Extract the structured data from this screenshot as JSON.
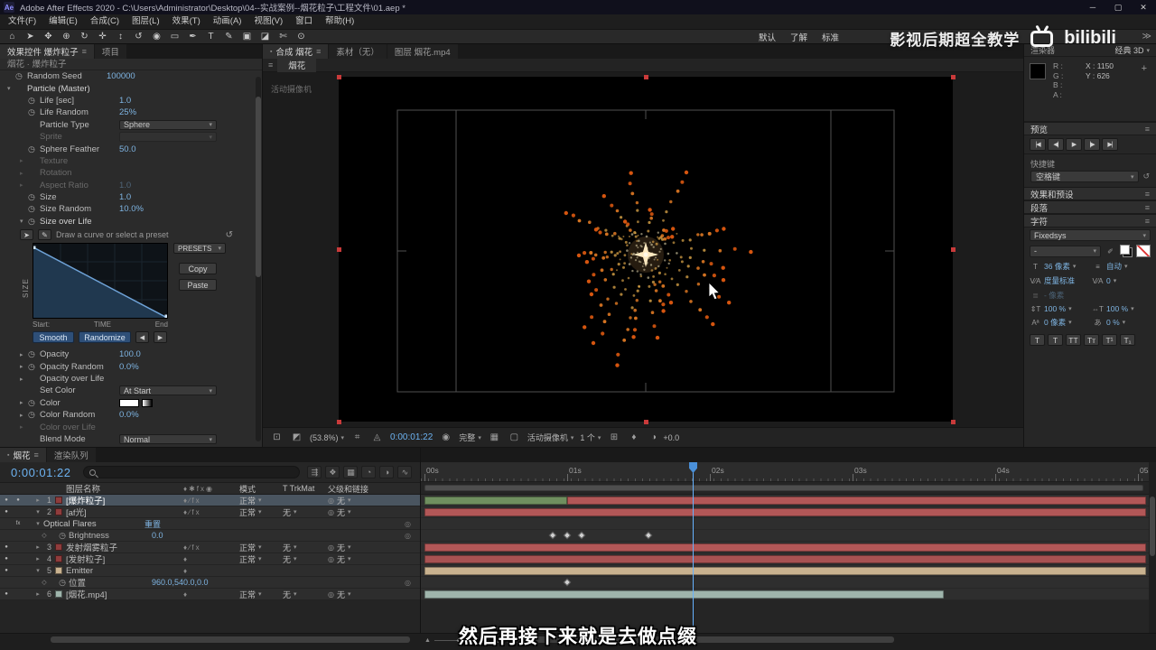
{
  "titlebar": {
    "logo": "Ae",
    "title": "Adobe After Effects 2020 - C:\\Users\\Administrator\\Desktop\\04--实战案例--烟花粒子\\工程文件\\01.aep *",
    "window_buttons": [
      "─",
      "▢",
      "✕"
    ]
  },
  "menubar": {
    "items": [
      "文件(F)",
      "编辑(E)",
      "合成(C)",
      "图层(L)",
      "效果(T)",
      "动画(A)",
      "视图(V)",
      "窗口",
      "帮助(H)"
    ]
  },
  "toolbar": {
    "tools": [
      {
        "g": "⌂",
        "n": "home-icon"
      },
      {
        "g": "➤",
        "n": "selection-tool"
      },
      {
        "g": "✥",
        "n": "hand-tool"
      },
      {
        "g": "⊕",
        "n": "zoom-tool"
      },
      {
        "g": "↻",
        "n": "orbit-camera-tool"
      },
      {
        "g": "✛",
        "n": "pan-camera-tool"
      },
      {
        "g": "↕",
        "n": "dolly-camera-tool"
      },
      {
        "g": "↺",
        "n": "rotation-tool"
      },
      {
        "g": "◉",
        "n": "pan-behind-tool"
      },
      {
        "g": "▭",
        "n": "shape-tool"
      },
      {
        "g": "✒",
        "n": "pen-tool"
      },
      {
        "g": "T",
        "n": "type-tool"
      },
      {
        "g": "✎",
        "n": "brush-tool"
      },
      {
        "g": "▣",
        "n": "clone-stamp-tool"
      },
      {
        "g": "◪",
        "n": "eraser-tool"
      },
      {
        "g": "✄",
        "n": "roto-brush-tool"
      },
      {
        "g": "⊙",
        "n": "puppet-pin-tool"
      }
    ],
    "workspaces": [
      "默认",
      "了解",
      "标准"
    ],
    "overflow": "≫",
    "watermark_text": "影视后期超全教学",
    "watermark_logo": "bilibili"
  },
  "effect_controls": {
    "tabs": [
      {
        "label": "效果控件 爆炸粒子",
        "cls": "active",
        "menu": 1
      },
      {
        "label": "项目"
      }
    ],
    "breadcrumb": "烟花 · 爆炸粒子",
    "rows_top": [
      {
        "tw": 1,
        "label": "Random Seed",
        "value": "100000",
        "nv": 1
      },
      {
        "a": "▾",
        "label": "Particle (Master)",
        "cls": "grp"
      },
      {
        "tw": 1,
        "label": "Life [sec]",
        "value": "1.0",
        "nv": 1,
        "cls": "i1"
      },
      {
        "tw": 1,
        "label": "Life Random",
        "value": "25%",
        "nv": 1,
        "cls": "i1"
      },
      {
        "label": "Particle Type",
        "value": "Sphere",
        "dd": 1,
        "cls": "i1"
      },
      {
        "label": "Sprite",
        "value": "",
        "dd": 1,
        "cls": "i1 dim"
      },
      {
        "tw": 1,
        "label": "Sphere Feather",
        "value": "50.0",
        "nv": 1,
        "cls": "i1"
      },
      {
        "a": "▸",
        "label": "Texture",
        "cls": "i1 dim"
      },
      {
        "a": "▸",
        "label": "Rotation",
        "cls": "i1 dim"
      },
      {
        "a": "▸",
        "label": "Aspect Ratio",
        "value": "1.0",
        "nv": 1,
        "cls": "i1 dim"
      },
      {
        "tw": 1,
        "label": "Size",
        "value": "1.0",
        "nv": 1,
        "cls": "i1"
      },
      {
        "tw": 1,
        "label": "Size Random",
        "value": "10.0%",
        "nv": 1,
        "cls": "i1"
      },
      {
        "a": "▾",
        "tw": 1,
        "label": "Size over Life",
        "cls": "i1 grp"
      }
    ],
    "curve": {
      "hint": "Draw a curve or select a preset",
      "presets": "PRESETS",
      "copy": "Copy",
      "paste": "Paste",
      "y_axis": "SIZE",
      "start": "Start:",
      "time": "TIME",
      "end": "End",
      "smooth": "Smooth",
      "randomize": "Randomize"
    },
    "rows_bottom": [
      {
        "a": "▸",
        "tw": 1,
        "label": "Opacity",
        "value": "100.0",
        "nv": 1,
        "cls": "i1"
      },
      {
        "a": "▸",
        "tw": 1,
        "label": "Opacity Random",
        "value": "0.0%",
        "nv": 1,
        "cls": "i1"
      },
      {
        "a": "▸",
        "label": "Opacity over Life",
        "cls": "i1"
      },
      {
        "label": "Set Color",
        "value": "At Start",
        "dd": 1,
        "cls": "i1"
      },
      {
        "a": "▸",
        "tw": 1,
        "label": "Color",
        "sw": 1,
        "cls": "i1"
      },
      {
        "a": "▸",
        "tw": 1,
        "label": "Color Random",
        "value": "0.0%",
        "nv": 1,
        "cls": "i1"
      },
      {
        "a": "▸",
        "label": "Color over Life",
        "cls": "i1 dim"
      },
      {
        "label": "Blend Mode",
        "value": "Normal",
        "dd": 1,
        "cls": "i1"
      }
    ]
  },
  "composition": {
    "tabs": [
      {
        "label": "合成 烟花",
        "cls": "active",
        "icon": 1,
        "menu": 1
      },
      {
        "label": "素材（无）"
      },
      {
        "label": "图层 烟花.mp4"
      }
    ],
    "viewer_tab": "烟花",
    "camera_label": "活动摄像机",
    "toolbar": {
      "zoom": "(53.8%)",
      "timecode": "0:00:01:22",
      "resolution": "完整",
      "view": "活动摄像机",
      "layout": "1 个",
      "exposure": "+0.0"
    }
  },
  "right_panel": {
    "renderer": {
      "label": "渲染器",
      "value": "经典 3D"
    },
    "info": {
      "r": "R :",
      "g": "G :",
      "b": "B :",
      "a": "A :",
      "x": "X : 1150",
      "y": "Y : 626",
      "plus": "+"
    },
    "preview": {
      "title": "预览",
      "buttons": [
        "|◀",
        "◀|",
        "▶",
        "|▶",
        "▶|"
      ]
    },
    "shortcut": {
      "label": "快捷键",
      "value": "空格键"
    },
    "effects_presets_title": "效果和预设",
    "paragraph_title": "段落",
    "character": {
      "title": "字符",
      "font_family": "Fixedsys",
      "font_style": "-",
      "size": "36 像素",
      "leading": "自动",
      "kerning": "度量标准",
      "tracking": "0",
      "stroke_width": "- 像素",
      "stroke_style": "",
      "vscale": "100 %",
      "hscale": "100 %",
      "baseline": "0 像素",
      "tsume": "0 %",
      "style_buttons": [
        "T",
        "T",
        "TT",
        "Tт",
        "T¹",
        "T₁"
      ]
    }
  },
  "timeline": {
    "tabs": [
      {
        "label": "烟花",
        "cls": "active",
        "icon": 1,
        "menu": 1
      },
      {
        "label": "渲染队列"
      }
    ],
    "timecode": "0:00:01:22",
    "columns": {
      "name": "图层名称",
      "switches": "♦✱fx◉",
      "mode": "模式",
      "trkmat": "T TrkMat",
      "parent": "父级和链接"
    },
    "view_icons": [
      "⇶",
      "❖",
      "▦",
      "◔",
      "◑",
      "∿"
    ],
    "ruler_labels": [
      "00s",
      "01s",
      "02s",
      "03s",
      "04s",
      "05s"
    ],
    "cti_seconds": 1.88,
    "rows": [
      {
        "type": "layer",
        "a": "▸",
        "num": "1",
        "name": "[爆炸粒子]",
        "chip": "#8f3c3c",
        "sw": "♦∕fx",
        "mode": "正常",
        "trk": "",
        "parent": "无",
        "sel": 1,
        "eye": 1,
        "solo": 1,
        "bars": [
          {
            "s": 0,
            "e": 1.0,
            "c": "#6f8f5f"
          },
          {
            "s": 1.0,
            "e": 5.06,
            "c": "#b25757"
          }
        ]
      },
      {
        "type": "layer",
        "a": "▾",
        "num": "2",
        "name": "[af光]",
        "chip": "#8f3c3c",
        "sw": "♦∕fx",
        "mode": "正常",
        "trk": "无",
        "parent": "无",
        "eye": 1,
        "bars": [
          {
            "s": 0,
            "e": 5.06,
            "c": "#b25757"
          }
        ]
      },
      {
        "type": "effect",
        "a": "▾",
        "name": "Optical Flares",
        "link": "重置"
      },
      {
        "type": "prop",
        "name": "Brightness",
        "value": "0.0",
        "keys": [
          0.9,
          1.0,
          1.1,
          1.57
        ]
      },
      {
        "type": "layer",
        "a": "▸",
        "num": "3",
        "name": "发射烟雾粒子",
        "chip": "#8f3c3c",
        "sw": "♦∕fx",
        "mode": "正常",
        "trk": "无",
        "parent": "无",
        "eye": 1,
        "bars": [
          {
            "s": 0,
            "e": 5.06,
            "c": "#b25757"
          }
        ]
      },
      {
        "type": "layer",
        "a": "▸",
        "num": "4",
        "name": "[发射粒子]",
        "chip": "#8f3c3c",
        "sw": "♦",
        "mode": "正常",
        "trk": "无",
        "parent": "无",
        "eye": 1,
        "bars": [
          {
            "s": 0,
            "e": 5.06,
            "c": "#a75252"
          }
        ]
      },
      {
        "type": "layer",
        "a": "▾",
        "num": "5",
        "name": "Emitter",
        "chip": "#c9b28f",
        "sw": "♦",
        "eye": 1,
        "bars": [
          {
            "s": 0,
            "e": 5.06,
            "c": "#c9b28f"
          }
        ]
      },
      {
        "type": "prop",
        "name": "位置",
        "value": "960.0,540.0,0.0",
        "keys": [
          1.0
        ]
      },
      {
        "type": "layer",
        "a": "▸",
        "num": "6",
        "name": "[烟花.mp4]",
        "chip": "#9fb5ac",
        "sw": "♦",
        "mode": "正常",
        "trk": "无",
        "parent": "无",
        "eye": 1,
        "bars": [
          {
            "s": 0,
            "e": 3.64,
            "c": "#9fb5ac"
          }
        ]
      }
    ]
  },
  "colors": {
    "accent_blue": "#6db3f2",
    "value_blue": "#7eb4e2",
    "selection": "#4a5560",
    "bar_red": "#b25757",
    "bar_tan": "#c9b28f",
    "bar_gray": "#9fb5ac",
    "bar_green": "#6f8f5f",
    "cti": "#66b2ff",
    "firework_inner": "#fff3c4",
    "firework_mid": "#ffc054",
    "firework_outer": "#e05a10"
  },
  "subtitle": "然后再接下来就是去做点缀"
}
